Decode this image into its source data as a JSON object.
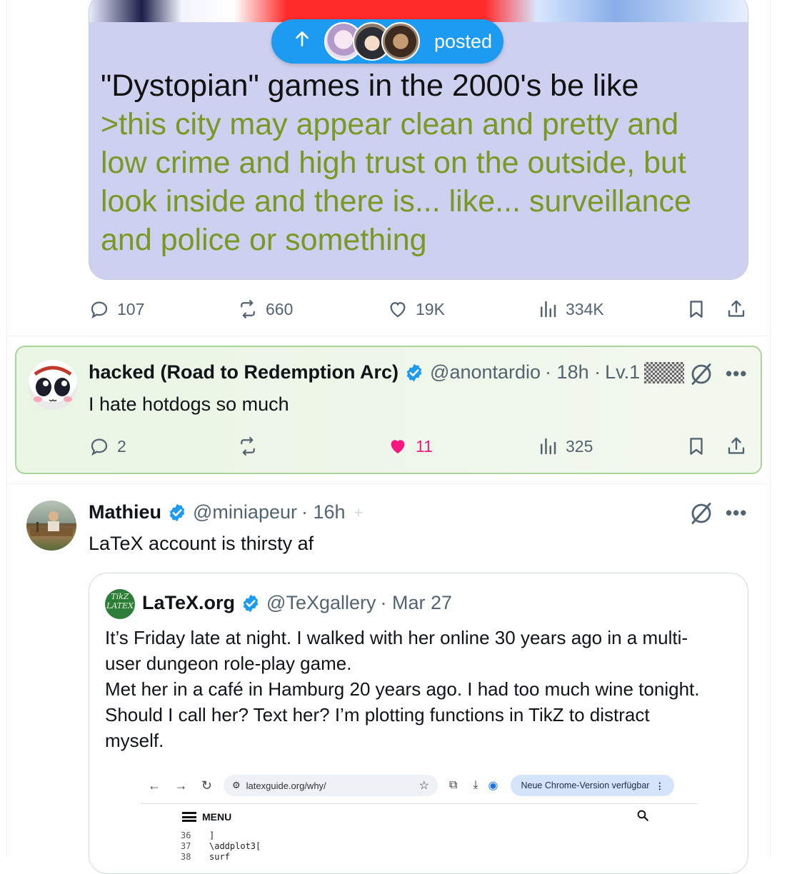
{
  "post1": {
    "pill_label": "posted",
    "title_line": "\"Dystopian\" games in the 2000's be like",
    "greentext": [
      ">this city may appear clean and pretty and",
      "low crime and high trust on the outside, but",
      "look inside and there is... like... surveillance",
      "and police or something"
    ],
    "replies": "107",
    "reposts": "660",
    "likes": "19K",
    "views": "334K"
  },
  "post2": {
    "name": "hacked (Road to Redemption Arc)",
    "handle": "@anontardio",
    "time": "· 18h ·",
    "level": "Lv.1",
    "text": "I hate hotdogs so much",
    "replies": "2",
    "reposts": "",
    "likes": "11",
    "views": "325",
    "like_color": "#f91880"
  },
  "post3": {
    "name": "Mathieu",
    "handle": "@miniapeur",
    "time": "· 16h",
    "text": "LaTeX account is thirsty af",
    "quote": {
      "logo_text": "TikZ LATEX",
      "name": "LaTeX.org",
      "handle": "@TeXgallery",
      "time": "· Mar 27",
      "lines": [
        "It’s Friday late at night. I walked with her online 30 years ago in a multi-",
        "user dungeon role-play game.",
        "Met her in a café in Hamburg 20 years ago. I had too much wine tonight.",
        "Should I call her? Text her? I’m plotting functions in TikZ to distract",
        "myself."
      ],
      "screenshot": {
        "url": "latexguide.org/why/",
        "update_button": "Neue Chrome-Version verfügbar",
        "menu": "MENU",
        "code": [
          {
            "ln": "36",
            "code": "]"
          },
          {
            "ln": "37",
            "code": "\\addplot3["
          },
          {
            "ln": "38",
            "code": "surf"
          }
        ]
      }
    }
  },
  "colors": {
    "accent": "#1d9bf0",
    "greentext": "#789922",
    "media_bg": "#cdd0ef"
  }
}
